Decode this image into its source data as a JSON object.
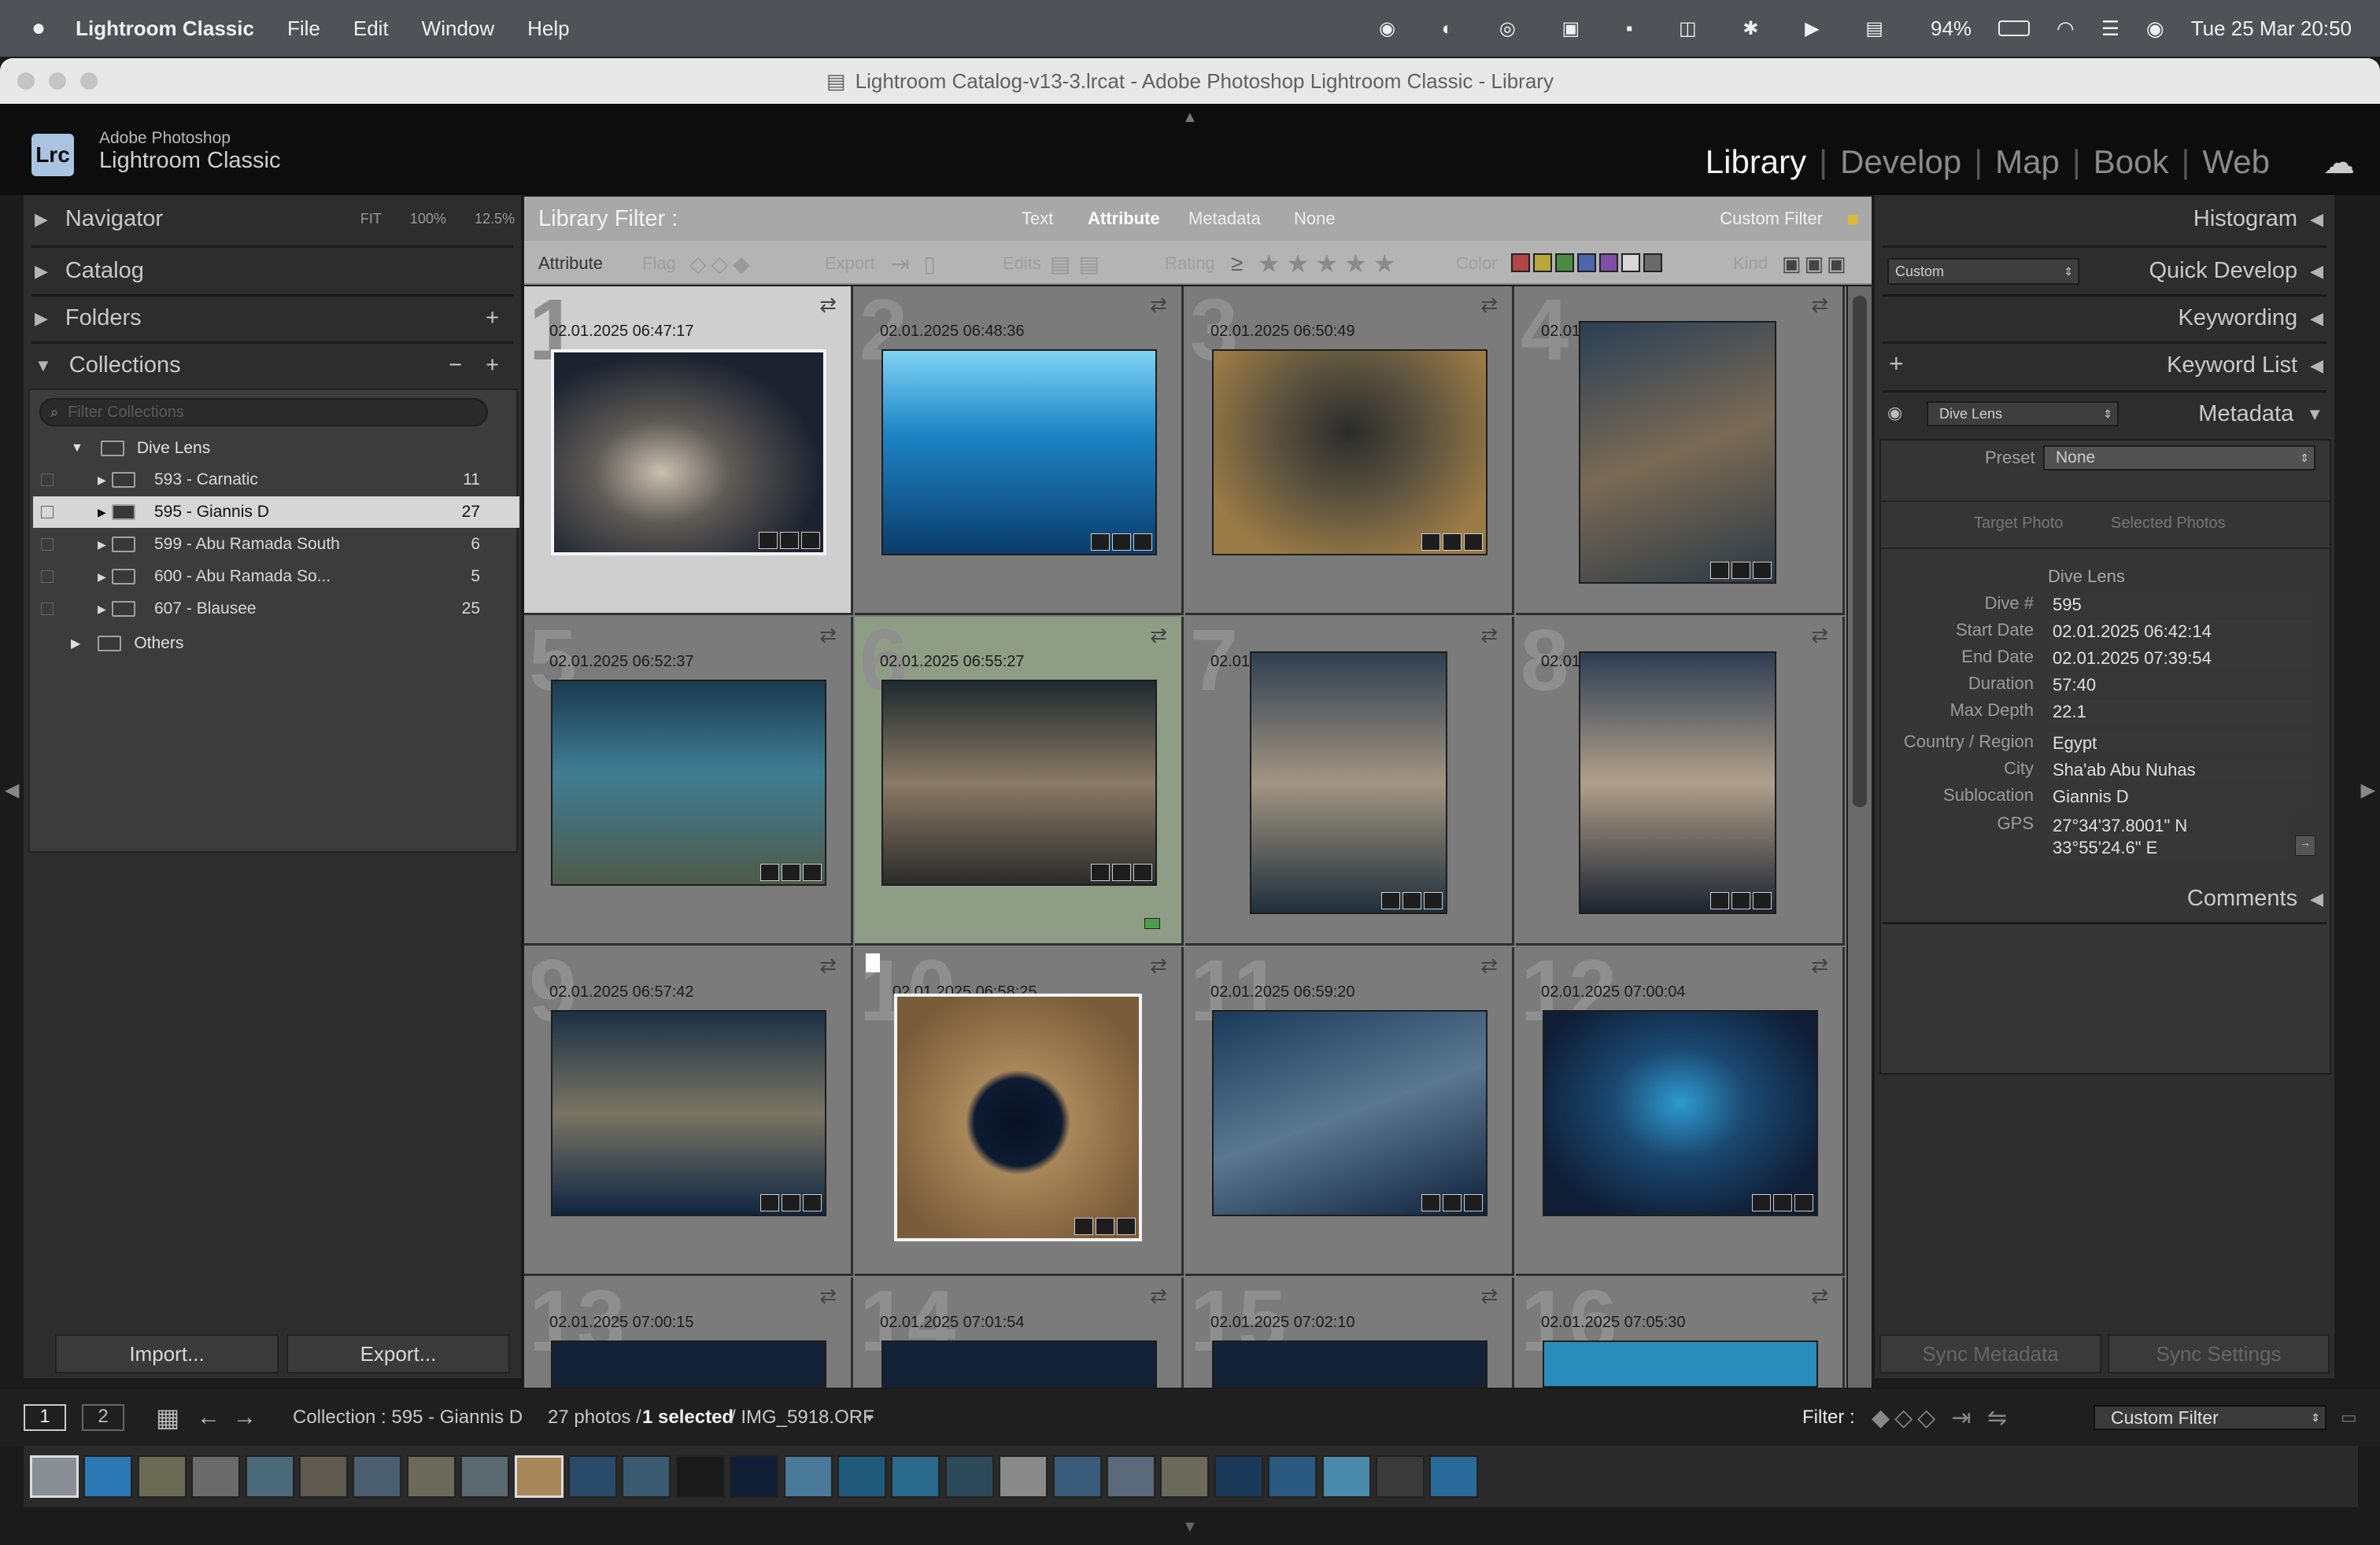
{
  "menubar": {
    "app": "Lightroom Classic",
    "items": [
      "File",
      "Edit",
      "Window",
      "Help"
    ],
    "battery": "94%",
    "clock": "Tue 25 Mar  20:50"
  },
  "window": {
    "title": "Lightroom Catalog-v13-3.lrcat - Adobe Photoshop Lightroom Classic - Library"
  },
  "identity": {
    "logo": "Lrc",
    "brand_top": "Adobe Photoshop",
    "brand_bottom": "Lightroom Classic",
    "modules": [
      "Library",
      "Develop",
      "Map",
      "Book",
      "Web"
    ],
    "active": "Library"
  },
  "left": {
    "navigator": "Navigator",
    "nav_zoom": [
      "FIT",
      "100%",
      "12.5%"
    ],
    "catalog": "Catalog",
    "folders": "Folders",
    "collections": "Collections",
    "filter_placeholder": "Filter Collections",
    "parent": "Dive Lens",
    "items": [
      {
        "name": "593 - Carnatic",
        "count": "11"
      },
      {
        "name": "595 - Giannis D",
        "count": "27"
      },
      {
        "name": "599 - Abu Ramada South",
        "count": "6"
      },
      {
        "name": "600 - Abu Ramada So...",
        "count": "5"
      },
      {
        "name": "607 - Blausee",
        "count": "25"
      }
    ],
    "others": "Others",
    "import": "Import...",
    "export": "Export..."
  },
  "filter": {
    "title": "Library Filter :",
    "tabs": [
      "Text",
      "Attribute",
      "Metadata",
      "None"
    ],
    "active_tab": "Attribute",
    "preset": "Custom Filter",
    "attr_label": "Attribute",
    "flag": "Flag",
    "export": "Export",
    "edits": "Edits",
    "rating": "Rating",
    "gte": "≥",
    "color": "Color",
    "kind": "Kind",
    "swatch_colors": [
      "#b24545",
      "#b8a83a",
      "#4a8c45",
      "#4c66ae",
      "#7d4fa6",
      "#d8d8d8",
      "#6a6a6a"
    ]
  },
  "grid": {
    "cells": [
      {
        "n": "1",
        "ts": "02.01.2025 06:47:17"
      },
      {
        "n": "2",
        "ts": "02.01.2025 06:48:36"
      },
      {
        "n": "3",
        "ts": "02.01.2025 06:50:49"
      },
      {
        "n": "4",
        "ts": "02.01.2025 06:51:55"
      },
      {
        "n": "5",
        "ts": "02.01.2025 06:52:37"
      },
      {
        "n": "6",
        "ts": "02.01.2025 06:55:27"
      },
      {
        "n": "7",
        "ts": "02.01.2025 06:56:25"
      },
      {
        "n": "8",
        "ts": "02.01.2025 06:56:58"
      },
      {
        "n": "9",
        "ts": "02.01.2025 06:57:42"
      },
      {
        "n": "10",
        "ts": "02.01.2025 06:58:25"
      },
      {
        "n": "11",
        "ts": "02.01.2025 06:59:20"
      },
      {
        "n": "12",
        "ts": "02.01.2025 07:00:04"
      },
      {
        "n": "13",
        "ts": "02.01.2025 07:00:15"
      },
      {
        "n": "14",
        "ts": "02.01.2025 07:01:54"
      },
      {
        "n": "15",
        "ts": "02.01.2025 07:02:10"
      },
      {
        "n": "16",
        "ts": "02.01.2025 07:05:30"
      }
    ]
  },
  "right": {
    "histogram": "Histogram",
    "quick_develop": "Quick Develop",
    "qd_preset": "Custom",
    "keywording": "Keywording",
    "keyword_list": "Keyword List",
    "metadata": "Metadata",
    "meta_set": "Dive Lens",
    "preset_label": "Preset",
    "preset_value": "None",
    "target_photo": "Target Photo",
    "selected_photos": "Selected Photos",
    "section": "Dive Lens",
    "fields": [
      {
        "k": "Dive #",
        "v": "595"
      },
      {
        "k": "Start Date",
        "v": "02.01.2025 06:42:14"
      },
      {
        "k": "End Date",
        "v": "02.01.2025 07:39:54"
      },
      {
        "k": "Duration",
        "v": "57:40"
      },
      {
        "k": "Max Depth",
        "v": "22.1"
      }
    ],
    "loc": [
      {
        "k": "Country / Region",
        "v": "Egypt"
      },
      {
        "k": "City",
        "v": "Sha'ab Abu Nuhas"
      },
      {
        "k": "Sublocation",
        "v": "Giannis D"
      }
    ],
    "gps_label": "GPS",
    "gps1": "27°34'37.8001\" N",
    "gps2": "33°55'24.6\" E",
    "comments": "Comments",
    "sync_meta": "Sync Metadata",
    "sync_settings": "Sync Settings"
  },
  "status": {
    "screen1": "1",
    "screen2": "2",
    "source": "Collection : 595 - Giannis D",
    "count": "27 photos /",
    "selected": "1 selected",
    "file": "/ IMG_5918.ORF",
    "filter_label": "Filter :",
    "filter_value": "Custom Filter"
  }
}
